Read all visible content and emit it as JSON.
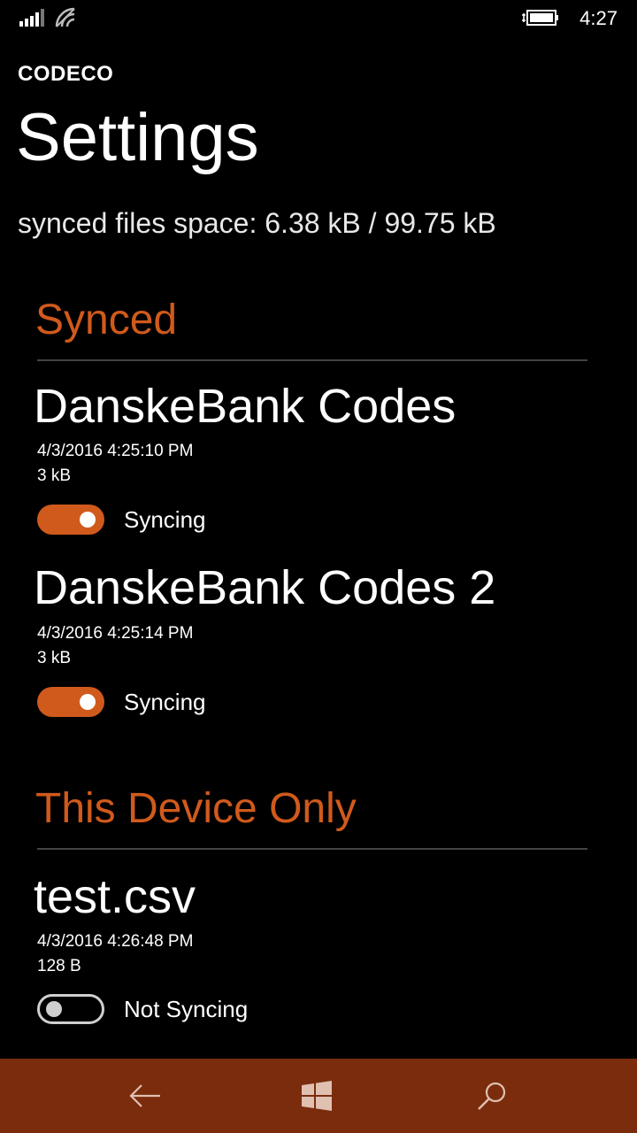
{
  "status_bar": {
    "time": "4:27"
  },
  "header": {
    "app_name": "CODECO",
    "title": "Settings",
    "space_info": "synced files space: 6.38 kB / 99.75 kB"
  },
  "sections": [
    {
      "title": "Synced",
      "files": [
        {
          "name": "DanskeBank Codes",
          "date": "4/3/2016 4:25:10 PM",
          "size": "3 kB",
          "toggle_on": true,
          "status": "Syncing"
        },
        {
          "name": "DanskeBank Codes 2",
          "date": "4/3/2016 4:25:14 PM",
          "size": "3 kB",
          "toggle_on": true,
          "status": "Syncing"
        }
      ]
    },
    {
      "title": "This Device Only",
      "files": [
        {
          "name": "test.csv",
          "date": "4/3/2016 4:26:48 PM",
          "size": "128 B",
          "toggle_on": false,
          "status": "Not Syncing"
        }
      ]
    }
  ],
  "nav": {
    "icons": [
      "back-arrow-icon",
      "windows-logo-icon",
      "search-icon"
    ]
  },
  "colors": {
    "accent": "#d05a1c",
    "navbar": "#7a2c0d",
    "background": "#000000"
  }
}
